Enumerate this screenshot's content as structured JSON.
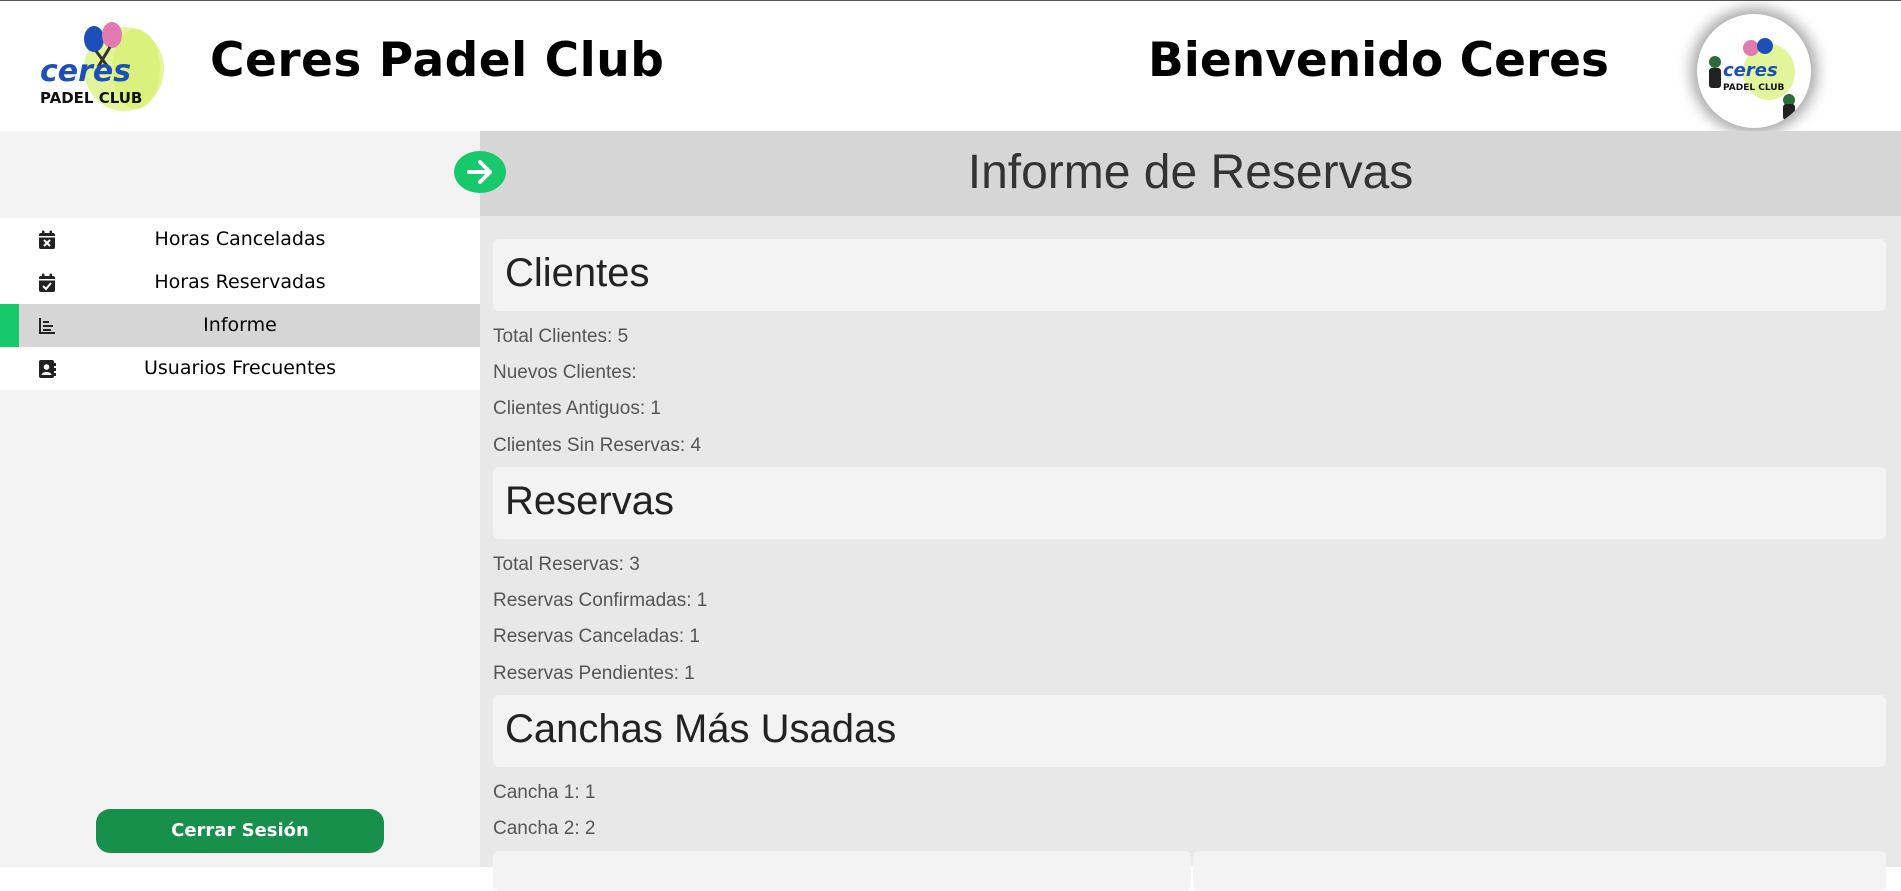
{
  "header": {
    "club_title": "Ceres Padel Club",
    "welcome": "Bienvenido Ceres",
    "logo_text_top": "ceres",
    "logo_text_bottom": "PADEL CLUB"
  },
  "sidebar": {
    "items": [
      {
        "label": "Horas Canceladas",
        "icon": "calendar-x-icon",
        "active": false
      },
      {
        "label": "Horas Reservadas",
        "icon": "calendar-check-icon",
        "active": false
      },
      {
        "label": "Informe",
        "icon": "chart-icon",
        "active": true
      },
      {
        "label": "Usuarios Frecuentes",
        "icon": "contact-book-icon",
        "active": false
      }
    ],
    "logout_label": "Cerrar Sesión"
  },
  "main": {
    "title": "Informe de Reservas",
    "sections": [
      {
        "title": "Clientes",
        "stats": [
          "Total Clientes: 5",
          "Nuevos Clientes:",
          "Clientes Antiguos: 1",
          "Clientes Sin Reservas: 4"
        ]
      },
      {
        "title": "Reservas",
        "stats": [
          "Total Reservas: 3",
          "Reservas Confirmadas: 1",
          "Reservas Canceladas: 1",
          "Reservas Pendientes: 1"
        ]
      },
      {
        "title": "Canchas Más Usadas",
        "stats": [
          "Cancha 1: 1",
          "Cancha 2: 2"
        ]
      }
    ]
  },
  "colors": {
    "accent_green": "#18c96b",
    "logout_green": "#17904c",
    "logo_blue": "#1d4fb8"
  }
}
